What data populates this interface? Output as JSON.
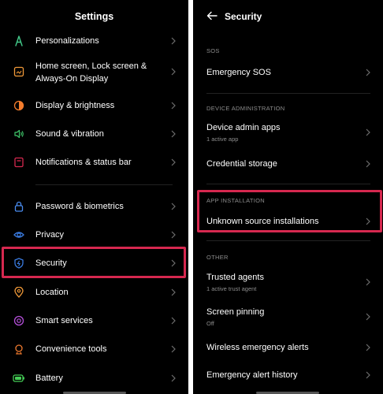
{
  "left": {
    "title": "Settings",
    "items": [
      {
        "name": "personalizations",
        "label": "Personalizations",
        "icon": "personalization-icon",
        "color": "#43c98a"
      },
      {
        "name": "home-screen",
        "label": "Home screen, Lock screen & Always-On Display",
        "line1": "Home screen, Lock screen &",
        "line2": "Always-On Display",
        "icon": "home-screen-icon",
        "color": "#f29a39"
      },
      {
        "name": "display",
        "label": "Display & brightness",
        "icon": "display-icon",
        "color": "#f47c2c"
      },
      {
        "name": "sound",
        "label": "Sound & vibration",
        "icon": "sound-icon",
        "color": "#3fc66a"
      },
      {
        "name": "notifications",
        "label": "Notifications & status bar",
        "icon": "notification-icon",
        "color": "#d6284f"
      },
      {
        "name": "password",
        "label": "Password & biometrics",
        "icon": "lock-icon",
        "color": "#4a8cf0"
      },
      {
        "name": "privacy",
        "label": "Privacy",
        "icon": "privacy-icon",
        "color": "#3a7be0"
      },
      {
        "name": "security",
        "label": "Security",
        "icon": "shield-icon",
        "color": "#3a7be0"
      },
      {
        "name": "location",
        "label": "Location",
        "icon": "location-icon",
        "color": "#f29a39"
      },
      {
        "name": "smart-services",
        "label": "Smart services",
        "icon": "smart-services-icon",
        "color": "#b34fd8"
      },
      {
        "name": "convenience-tools",
        "label": "Convenience tools",
        "icon": "convenience-tools-icon",
        "color": "#f07a2e"
      },
      {
        "name": "battery",
        "label": "Battery",
        "icon": "battery-icon",
        "color": "#44cc55"
      }
    ]
  },
  "right": {
    "title": "Security",
    "sections": {
      "sos": "SOS",
      "device_admin": "DEVICE ADMINISTRATION",
      "app_install": "APP INSTALLATION",
      "other": "OTHER"
    },
    "items": {
      "emergency_sos": {
        "label": "Emergency SOS"
      },
      "device_admin_apps": {
        "label": "Device admin apps",
        "sub": "1 active app"
      },
      "credential_storage": {
        "label": "Credential storage"
      },
      "unknown_sources": {
        "label": "Unknown source installations"
      },
      "trusted_agents": {
        "label": "Trusted agents",
        "sub": "1 active trust agent"
      },
      "screen_pinning": {
        "label": "Screen pinning",
        "sub": "Off"
      },
      "wireless_alerts": {
        "label": "Wireless emergency alerts"
      },
      "alert_history": {
        "label": "Emergency alert history"
      }
    }
  },
  "colors": {
    "background": "#000000",
    "highlight": "#d6284f",
    "text": "#ffffff",
    "secondary": "#8d8d8d"
  }
}
